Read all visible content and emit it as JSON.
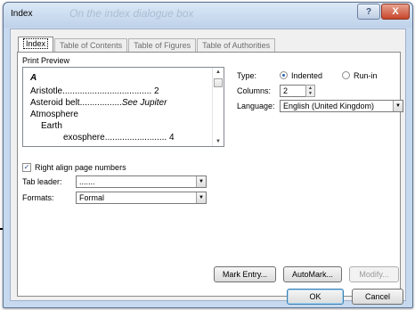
{
  "window": {
    "title": "Index",
    "title_ghost": "On the index dialogue box",
    "help_label": "?",
    "close_label": "X"
  },
  "tabs": [
    {
      "label": "Index"
    },
    {
      "label": "Table of Contents"
    },
    {
      "label": "Table of Figures"
    },
    {
      "label": "Table of Authorities"
    }
  ],
  "preview": {
    "title": "Print Preview",
    "heading": "A",
    "entries": [
      {
        "left": "Aristotle",
        "dots": "....................................",
        "right": "2"
      },
      {
        "left": "Asteroid belt",
        "dots": ".................",
        "right": "See Jupiter"
      },
      {
        "left": "Atmosphere",
        "dots": "",
        "right": ""
      },
      {
        "left": "Earth",
        "dots": "",
        "right": ""
      },
      {
        "left": "exosphere",
        "dots": ".........................",
        "right": "4"
      }
    ]
  },
  "type": {
    "label": "Type:",
    "options": [
      "Indented",
      "Run-in"
    ],
    "selected": "Indented"
  },
  "columns": {
    "label": "Columns:",
    "value": "2"
  },
  "language": {
    "label": "Language:",
    "value": "English (United Kingdom)"
  },
  "right_align": {
    "label": "Right align page numbers",
    "checked": true,
    "check_glyph": "✓"
  },
  "tab_leader": {
    "label": "Tab leader:",
    "value": "......."
  },
  "formats": {
    "label": "Formats:",
    "value": "Formal"
  },
  "buttons": {
    "mark_entry": "Mark Entry...",
    "automark": "AutoMark...",
    "modify": "Modify...",
    "ok": "OK",
    "cancel": "Cancel"
  },
  "icons": {
    "up_arrow": "▲",
    "down_arrow": "▼",
    "chevron": "▼"
  }
}
